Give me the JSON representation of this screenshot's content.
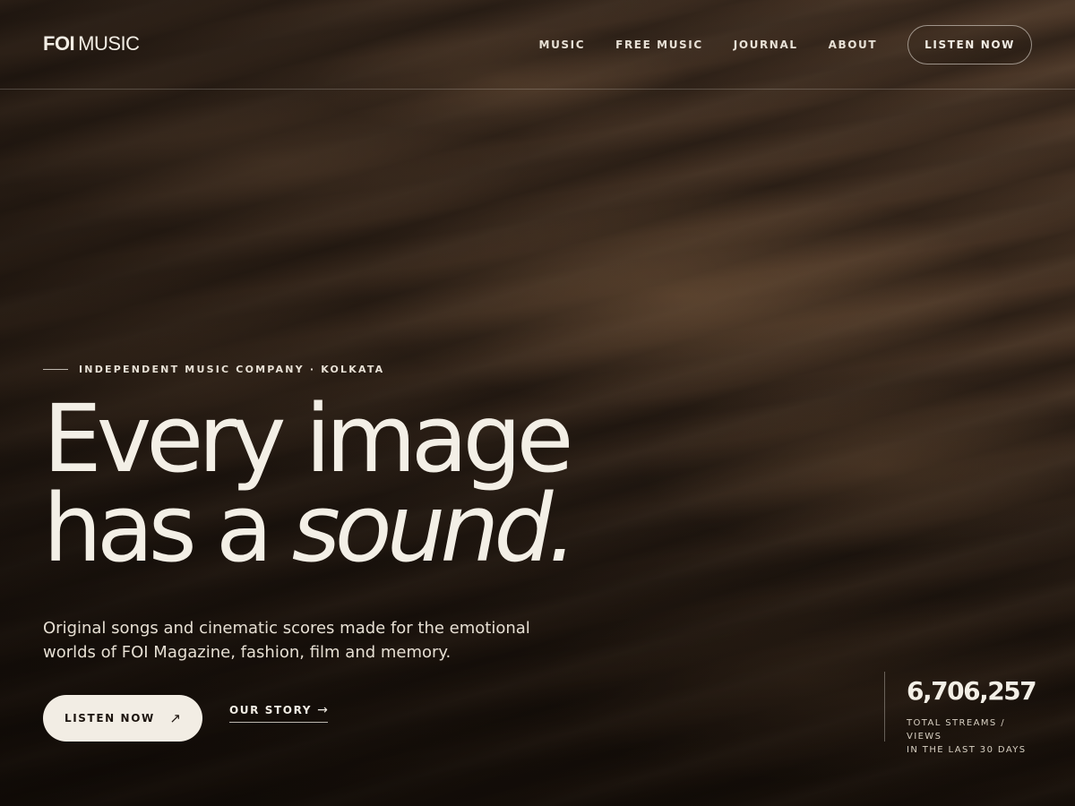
{
  "header": {
    "logo_bold": "FOI",
    "logo_light": "MUSIC",
    "nav": [
      {
        "label": "MUSIC"
      },
      {
        "label": "FREE MUSIC"
      },
      {
        "label": "JOURNAL"
      },
      {
        "label": "ABOUT"
      }
    ],
    "cta_label": "LISTEN NOW"
  },
  "hero": {
    "eyebrow": "INDEPENDENT MUSIC COMPANY · KOLKATA",
    "headline_line1": "Every image",
    "headline_line2_plain": "has a ",
    "headline_line2_italic": "sound.",
    "subcopy": "Original songs and cinematic scores made for the emotional worlds of FOI Magazine, fashion, film and memory.",
    "primary_button": {
      "label": "LISTEN NOW",
      "icon": "arrow-ne-icon",
      "glyph": "↗"
    },
    "secondary_button": {
      "label": "OUR STORY",
      "icon": "arrow-right-icon",
      "glyph": "→"
    }
  },
  "stats": {
    "value": "6,706,257",
    "caption_line1": "TOTAL STREAMS / VIEWS",
    "caption_line2": "IN THE LAST 30 DAYS"
  },
  "colors": {
    "text": "#f2ede4",
    "button_bg": "#f2ede4",
    "button_text": "#1c140e",
    "background_dark": "#24180f"
  }
}
